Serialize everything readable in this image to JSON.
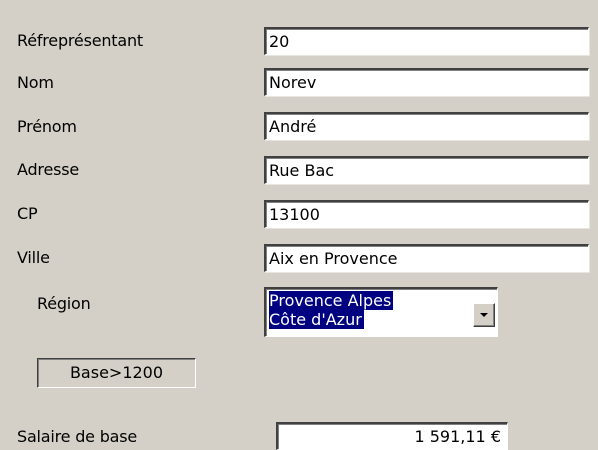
{
  "form": {
    "fields": [
      {
        "label": "Réfreprésentant",
        "value": "20"
      },
      {
        "label": "Nom",
        "value": "Norev"
      },
      {
        "label": "Prénom",
        "value": "André"
      },
      {
        "label": "Adresse",
        "value": "Rue Bac"
      },
      {
        "label": "CP",
        "value": "13100"
      },
      {
        "label": "Ville",
        "value": "Aix en Provence"
      }
    ],
    "region": {
      "label": "Région",
      "value_line1": "Provence Alpes",
      "value_line2": "Côte d'Azur",
      "dropdown_icon": "chevron-down-icon"
    },
    "filter_button": {
      "label": "Base>1200"
    },
    "salary": {
      "label": "Salaire de base",
      "value": "1 591,11 €"
    }
  },
  "colors": {
    "background": "#d4d0c8",
    "field_background": "#ffffff",
    "selection": "#000080"
  }
}
